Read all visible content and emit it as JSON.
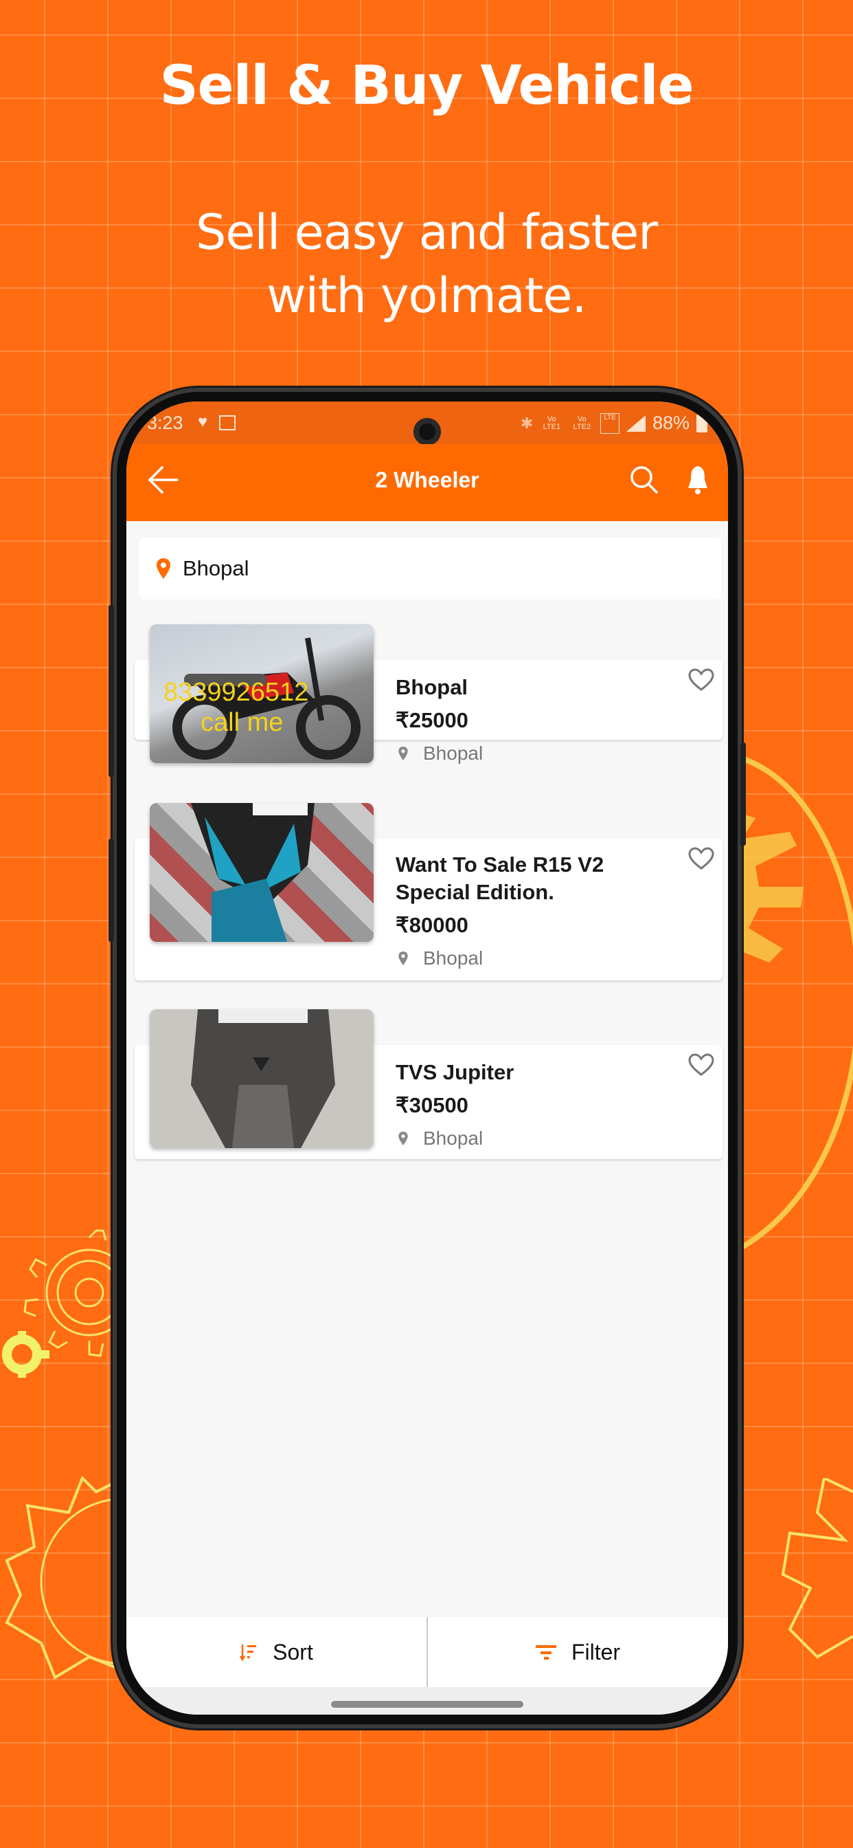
{
  "promo": {
    "headline": "Sell & Buy Vehicle",
    "subline_1": "Sell easy and faster",
    "subline_2": "with yolmate."
  },
  "colors": {
    "brand_orange": "#ff6a00",
    "background_orange": "#ff6c12",
    "gear_yellow": "#f7c948"
  },
  "status_bar": {
    "time": "3:23",
    "left_icons": [
      "health-icon",
      "image-icon"
    ],
    "right_icons": [
      "bluetooth-icon",
      "volte1-icon",
      "volte2-icon",
      "sim1-signal-icon",
      "sim2-signal-icon"
    ],
    "volte1": "Vo LTE1",
    "volte2": "Vo LTE2",
    "network": "LTE",
    "battery": "88%"
  },
  "app_bar": {
    "title": "2 Wheeler",
    "back_icon": "arrow-left-icon",
    "search_icon": "search-icon",
    "notification_icon": "bell-icon"
  },
  "location": {
    "label": "Bhopal",
    "icon": "map-pin-icon"
  },
  "listings": [
    {
      "title": "Bhopal",
      "price": "₹25000",
      "location": "Bhopal",
      "image_overlay_1": "8339926512",
      "image_overlay_2": "call me",
      "image": "red-black-motorcycle-photo",
      "favorited": false
    },
    {
      "title": "Want To Sale R15 V2 Special Edition.",
      "price": "₹80000",
      "location": "Bhopal",
      "image": "blue-sport-bike-photo",
      "favorited": false
    },
    {
      "title": "TVS Jupiter",
      "price": "₹30500",
      "location": "Bhopal",
      "image": "grey-scooter-photo",
      "favorited": false
    }
  ],
  "bottom_bar": {
    "sort_label": "Sort",
    "filter_label": "Filter"
  }
}
